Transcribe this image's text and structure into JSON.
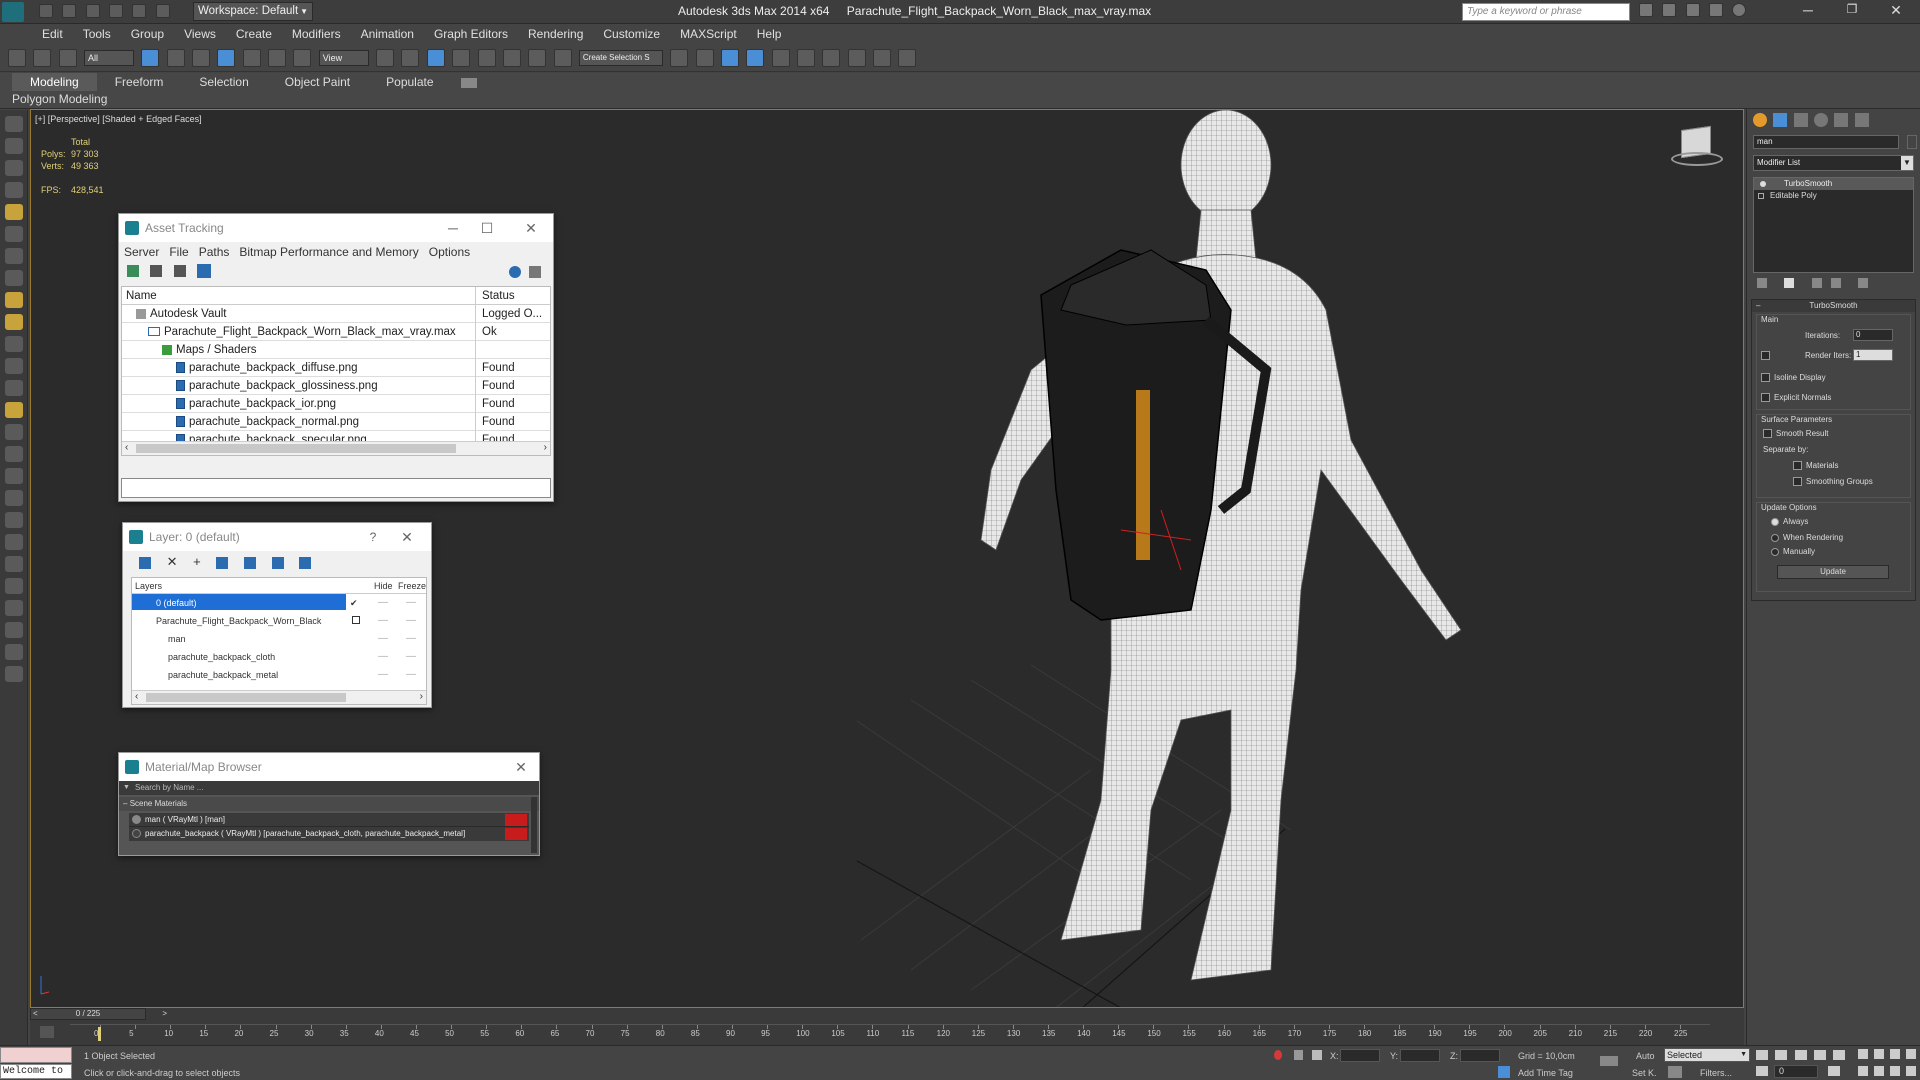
{
  "window": {
    "title": "Autodesk 3ds Max  2014 x64",
    "file": "Parachute_Flight_Backpack_Worn_Black_max_vray.max",
    "workspace": "Workspace: Default",
    "search_placeholder": "Type a keyword or phrase"
  },
  "menu": [
    "Edit",
    "Tools",
    "Group",
    "Views",
    "Create",
    "Modifiers",
    "Animation",
    "Graph Editors",
    "Rendering",
    "Customize",
    "MAXScript",
    "Help"
  ],
  "toolbar": {
    "filter": "All",
    "view": "View",
    "selection_set": "Create Selection S"
  },
  "ribbon": {
    "tabs": [
      "Modeling",
      "Freeform",
      "Selection",
      "Object Paint",
      "Populate"
    ],
    "sub": "Polygon Modeling"
  },
  "viewport": {
    "label": "[+] [Perspective] [Shaded + Edged Faces]",
    "stats_total": "Total",
    "polys_label": "Polys:",
    "polys": "97 303",
    "verts_label": "Verts:",
    "verts": "49 363",
    "fps_label": "FPS:",
    "fps": "428,541"
  },
  "asset_tracking": {
    "title": "Asset Tracking",
    "menu": [
      "Server",
      "File",
      "Paths",
      "Bitmap Performance and Memory",
      "Options"
    ],
    "col_name": "Name",
    "col_status": "Status",
    "rows": [
      {
        "name": "Autodesk Vault",
        "status": "Logged O..."
      },
      {
        "name": "Parachute_Flight_Backpack_Worn_Black_max_vray.max",
        "status": "Ok"
      },
      {
        "name": "Maps / Shaders",
        "status": ""
      },
      {
        "name": "parachute_backpack_diffuse.png",
        "status": "Found"
      },
      {
        "name": "parachute_backpack_glossiness.png",
        "status": "Found"
      },
      {
        "name": "parachute_backpack_ior.png",
        "status": "Found"
      },
      {
        "name": "parachute_backpack_normal.png",
        "status": "Found"
      },
      {
        "name": "parachute_backpack_specular.png",
        "status": "Found"
      }
    ]
  },
  "layer": {
    "title": "Layer: 0 (default)",
    "help": "?",
    "col_layers": "Layers",
    "col_hide": "Hide",
    "col_freeze": "Freeze",
    "rows": [
      {
        "name": "0 (default)"
      },
      {
        "name": "Parachute_Flight_Backpack_Worn_Black"
      },
      {
        "name": "man"
      },
      {
        "name": "parachute_backpack_cloth"
      },
      {
        "name": "parachute_backpack_metal"
      }
    ]
  },
  "material_browser": {
    "title": "Material/Map Browser",
    "search_placeholder": "Search by Name ...",
    "section": "Scene Materials",
    "items": [
      "man  ( VRayMtl )  [man]",
      "parachute_backpack  ( VRayMtl )  [parachute_backpack_cloth, parachute_backpack_metal]"
    ]
  },
  "cmd_panel": {
    "name_field": "man",
    "modifier_list": "Modifier List",
    "stack": [
      "TurboSmooth",
      "Editable Poly"
    ],
    "rollout": "TurboSmooth",
    "main": "Main",
    "iterations_label": "Iterations:",
    "iterations": "0",
    "render_iters_label": "Render Iters:",
    "render_iters": "1",
    "isoline": "Isoline Display",
    "explicit": "Explicit Normals",
    "surface": "Surface Parameters",
    "smooth_result": "Smooth Result",
    "separate_by": "Separate by:",
    "materials": "Materials",
    "smoothing_groups": "Smoothing Groups",
    "update_options": "Update Options",
    "always": "Always",
    "when_rendering": "When Rendering",
    "manually": "Manually",
    "update": "Update"
  },
  "timeline": {
    "frame": "0 / 225",
    "ticks": [
      "0",
      "5",
      "10",
      "15",
      "20",
      "25",
      "30",
      "35",
      "40",
      "45",
      "50",
      "55",
      "60",
      "65",
      "70",
      "75",
      "80",
      "85",
      "90",
      "95",
      "100",
      "105",
      "110",
      "115",
      "120",
      "125",
      "130",
      "135",
      "140",
      "145",
      "150",
      "155",
      "160",
      "165",
      "170",
      "175",
      "180",
      "185",
      "190",
      "195",
      "200",
      "205",
      "210",
      "215",
      "220",
      "225"
    ]
  },
  "status": {
    "welcome": "Welcome to",
    "selected": "1 Object Selected",
    "hint": "Click or click-and-drag to select objects",
    "x": "X:",
    "y": "Y:",
    "z": "Z:",
    "grid": "Grid = 10,0cm",
    "auto": "Auto",
    "selected_dd": "Selected",
    "setk": "Set K.",
    "filters": "Filters...",
    "add_time_tag": "Add Time Tag",
    "frame": "0"
  }
}
